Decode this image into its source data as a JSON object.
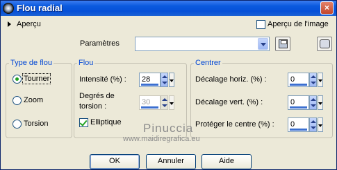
{
  "window": {
    "title": "Flou radial",
    "close_label": "×"
  },
  "preview": {
    "label": "Aperçu",
    "preview_toggle_label": "Aperçu de l'image",
    "preview_checked": false
  },
  "params": {
    "label": "Paramètres",
    "value": ""
  },
  "type_de_flou": {
    "legend": "Type de flou",
    "options": [
      {
        "label": "Tourner",
        "checked": true
      },
      {
        "label": "Zoom",
        "checked": false
      },
      {
        "label": "Torsion",
        "checked": false
      }
    ]
  },
  "flou": {
    "legend": "Flou",
    "intensite_label": "Intensité (%) :",
    "intensite_value": "28",
    "torsion_label_1": "Degrés de",
    "torsion_label_2": "torsion :",
    "torsion_value": "30",
    "elliptique_label": "Elliptique",
    "elliptique_checked": true
  },
  "centrer": {
    "legend": "Centrer",
    "horiz_label": "Décalage horiz. (%) :",
    "horiz_value": "0",
    "vert_label": "Décalage vert. (%) :",
    "vert_value": "0",
    "protect_label": "Protéger le centre (%) :",
    "protect_value": "0"
  },
  "watermark": {
    "line1": "Pinuccia",
    "line2": "www.maidiregrafica.eu"
  },
  "buttons": {
    "ok": "OK",
    "cancel": "Annuler",
    "help": "Aide"
  },
  "icons": {
    "app": "radial-blur-icon",
    "save": "save-disk-icon",
    "tools": "preset-tools-icon"
  }
}
